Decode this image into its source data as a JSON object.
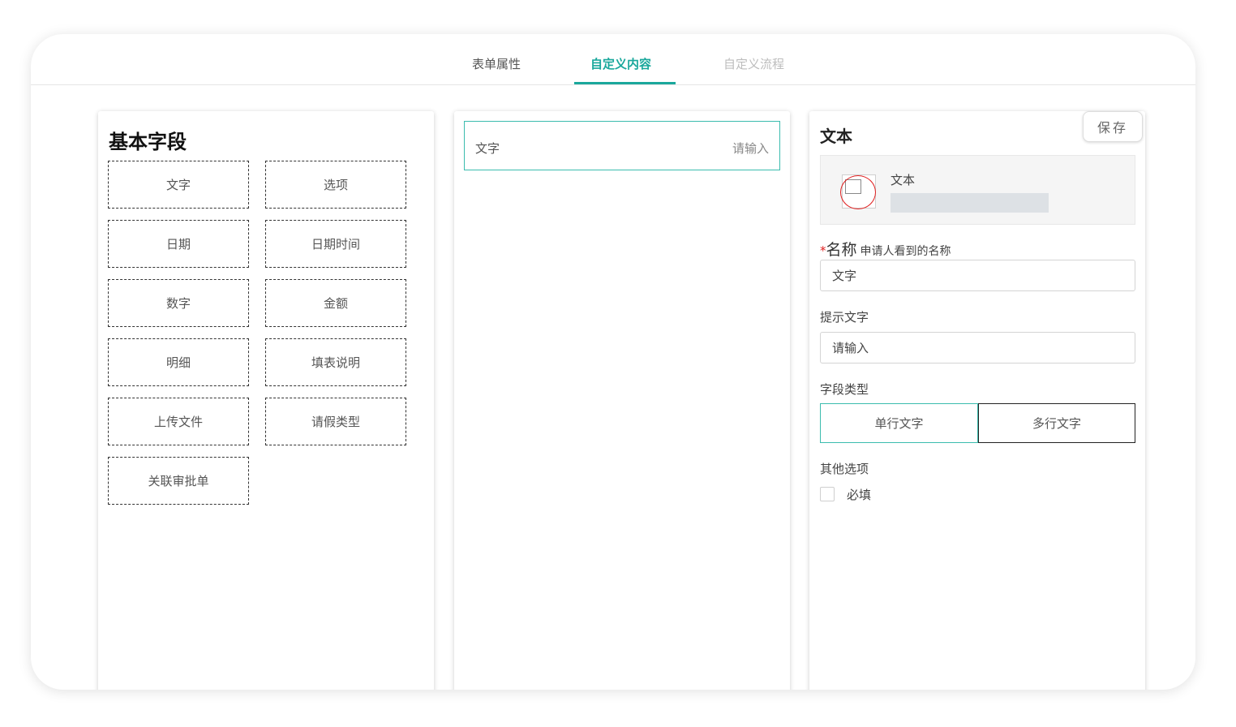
{
  "tabs": [
    {
      "label": "表单属性"
    },
    {
      "label": "自定义内容"
    },
    {
      "label": "自定义流程"
    }
  ],
  "left_panel": {
    "title": "基本字段",
    "fields": [
      "文字",
      "选项",
      "日期",
      "日期时间",
      "数字",
      "金额",
      "明细",
      "填表说明",
      "上传文件",
      "请假类型",
      "关联审批单"
    ]
  },
  "middle_panel": {
    "field_label": "文字",
    "field_placeholder": "请输入"
  },
  "right_panel": {
    "title": "文本",
    "save_label": "保存",
    "preview_label": "文本",
    "name_label": "名称",
    "name_required_mark": "*",
    "name_hint": "申请人看到的名称",
    "name_value": "文字",
    "placeholder_label": "提示文字",
    "placeholder_value": "请输入",
    "type_label": "字段类型",
    "type_options": [
      "单行文字",
      "多行文字"
    ],
    "other_label": "其他选项",
    "required_checkbox_label": "必填",
    "required_checked": false
  },
  "colors": {
    "accent": "#1aa89c",
    "required": "#e02020"
  }
}
